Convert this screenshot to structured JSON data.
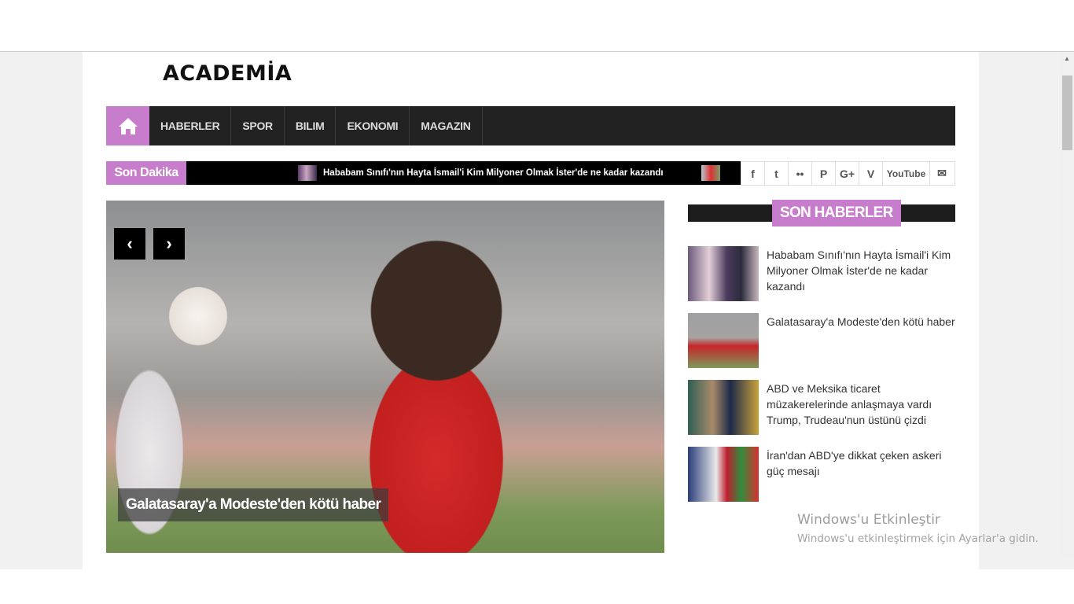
{
  "logo": "ACADEMİA",
  "nav": {
    "items": [
      "HABERLER",
      "SPOR",
      "BILIM",
      "EKONOMI",
      "MAGAZIN"
    ]
  },
  "ticker": {
    "label": "Son Dakika",
    "headline": "Hababam Sınıfı'nın Hayta İsmail'i Kim Milyoner Olmak İster'de ne kadar kazandı"
  },
  "social": [
    "f",
    "t",
    "••",
    "P",
    "G+",
    "V",
    "YouTube",
    "✉"
  ],
  "slider": {
    "caption": "Galatasaray'a Modeste'den kötü haber",
    "prev": "‹",
    "next": "›"
  },
  "sidebar": {
    "title": "SON HABERLER",
    "items": [
      {
        "text": "Hababam Sınıfı'nın Hayta İsmail'i Kim Milyoner Olmak İster'de ne kadar kazandı"
      },
      {
        "text": "Galatasaray'a Modeste'den kötü haber"
      },
      {
        "text": "ABD ve Meksika ticaret müzakerelerinde anlaşmaya vardı Trump, Trudeau'nun üstünü çizdi"
      },
      {
        "text": "İran'dan ABD'ye dikkat çeken askeri güç mesajı"
      }
    ]
  },
  "watermark": {
    "line1": "Windows'u Etkinleştir",
    "line2": "Windows'u etkinleştirmek için Ayarlar'a gidin."
  },
  "colors": {
    "accent": "#c77dcc",
    "nav_bg": "#222222"
  }
}
